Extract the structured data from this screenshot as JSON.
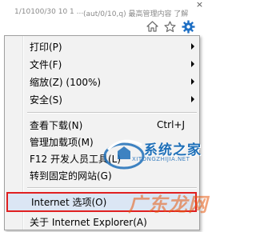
{
  "browser": {
    "background_fragments": [
      "1/10100/30 10 1 ...",
      "(aut/0/10,q) 最高管理内容 了解"
    ],
    "toolbar_icons": [
      "home-icon",
      "star-icon",
      "gear-icon"
    ],
    "accent": "#1e6fc4"
  },
  "menu": {
    "items": [
      {
        "label": "打印(P)",
        "submenu": true
      },
      {
        "label": "文件(F)",
        "submenu": true
      },
      {
        "label": "缩放(Z) (100%)",
        "submenu": true
      },
      {
        "label": "安全(S)",
        "submenu": true
      },
      {
        "label": "查看下载(N)",
        "shortcut": "Ctrl+J"
      },
      {
        "label": "管理加载项(M)"
      },
      {
        "label": "F12 开发人员工具(L)"
      },
      {
        "label": "转到固定的网站(G)"
      },
      {
        "label": "Internet 选项(O)",
        "highlighted": true
      },
      {
        "label": "关于 Internet Explorer(A)"
      }
    ],
    "highlight_border_color": "#e02020"
  },
  "watermarks": {
    "site1_name": "系统之家",
    "site1_url": "XITONGZHIJIA.NET",
    "site2_name": "广东龙网"
  }
}
